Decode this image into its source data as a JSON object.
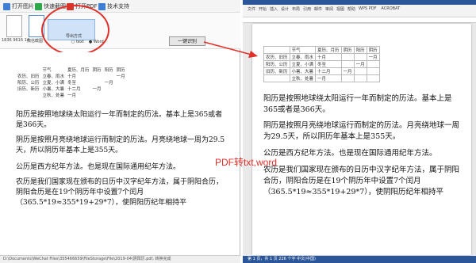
{
  "left_app": {
    "toolbar": [
      {
        "label": "打开图片",
        "color": "#3d7fd6"
      },
      {
        "label": "快速截图",
        "color": "#2aa84a"
      },
      {
        "label": "打开PDF",
        "color": "#d9342b"
      },
      {
        "label": "技术支持",
        "color": "#3d7fd6"
      }
    ],
    "thumbs": [
      {
        "label": "1836 9616 14"
      },
      {
        "label": "微信截图"
      }
    ],
    "dropdown": {
      "title": "导出方式",
      "option_a": "text",
      "option_b": "Word"
    },
    "convert_label": "一键识别",
    "status_path": "D:\\Documents\\WeChat Files\\355466659\\FileStorage\\File\\2019-04\\阴阳历.pdf, 转换完成"
  },
  "document": {
    "table_header": [
      "",
      "节气",
      "",
      "",
      "",
      ""
    ],
    "table_rows": [
      [
        "",
        "节气",
        "夏历、月历",
        "阴历",
        "阳历",
        "阴历"
      ],
      [
        "农历、旧历",
        "立春、雨水",
        "十月",
        "",
        "",
        "一月"
      ],
      [
        "阳历、公历",
        "立夏、小满",
        "冬至",
        "",
        "一月",
        ""
      ],
      [
        "旧历、新历",
        "小暑、大暑",
        "十二月",
        "一月",
        "",
        ""
      ],
      [
        "",
        "立秋、处暑",
        "一月",
        "",
        "",
        ""
      ]
    ],
    "p1": "阳历是按照地球绕太阳运行一年而制定的历法。基本上是365或者是366天。",
    "p2": "阴历是按照月亮绕地球运行而制定的历法。月亮绕地球一周为29.5天，所以阴历年基本上是355天。",
    "p3": "公历是西方纪年方法。也是现在国际通用纪年方法。",
    "p4": "农历是我们国家现在颁布的日历中汉字纪年方法，属于阴阳合历，阴阳合历是在19个阴历年中设置7个闰月（365.5*19≈355*19+29*7），使阴阳历纪年相持平"
  },
  "annotation": {
    "label": "PDF转txt,word",
    "color": "#e0302a"
  },
  "word": {
    "tabs": [
      "文件",
      "开始",
      "插入",
      "设计",
      "布局",
      "引用",
      "邮件",
      "审阅",
      "视图",
      "帮助",
      "WPS PDF",
      "ACROBAT"
    ],
    "status": "第 1 页，共 1 页    226 个字    中文(中国)"
  }
}
